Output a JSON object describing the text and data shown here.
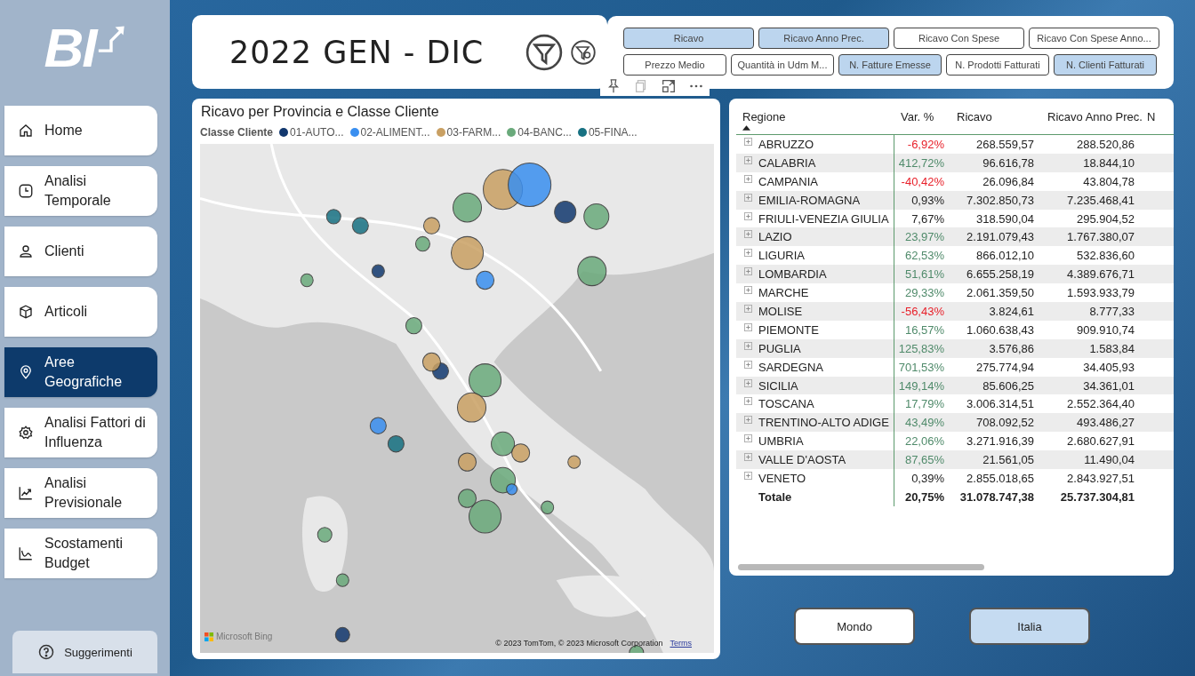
{
  "logo": "BI",
  "nav": [
    {
      "label": "Home",
      "kind": "home",
      "selected": false
    },
    {
      "label": "Analisi Temporale",
      "kind": "clock",
      "selected": false
    },
    {
      "label": "Clienti",
      "kind": "person",
      "selected": false
    },
    {
      "label": "Articoli",
      "kind": "box",
      "selected": false
    },
    {
      "label": "Aree Geografiche",
      "kind": "pin",
      "selected": true
    },
    {
      "label": "Analisi Fattori di Influenza",
      "kind": "gear",
      "selected": false
    },
    {
      "label": "Analisi Previsionale",
      "kind": "trend",
      "selected": false
    },
    {
      "label": "Scostamenti Budget",
      "kind": "curve",
      "selected": false
    }
  ],
  "help_button": "Suggerimenti",
  "title": "2022 GEN - DIC",
  "measures": [
    [
      {
        "label": "Ricavo",
        "selected": true
      },
      {
        "label": "Ricavo Anno Prec.",
        "selected": true
      },
      {
        "label": "Ricavo Con Spese",
        "selected": false
      },
      {
        "label": "Ricavo Con Spese Anno...",
        "selected": false
      }
    ],
    [
      {
        "label": "Prezzo Medio",
        "selected": false
      },
      {
        "label": "Quantità in Udm M...",
        "selected": false
      },
      {
        "label": "N. Fatture Emesse",
        "selected": true
      },
      {
        "label": "N. Prodotti Fatturati",
        "selected": false
      },
      {
        "label": "N. Clienti Fatturati",
        "selected": true
      }
    ]
  ],
  "map": {
    "title": "Ricavo per Provincia e Classe Cliente",
    "legend_title": "Classe Cliente",
    "legend": [
      {
        "label": "01-AUTO...",
        "color": "#12386e"
      },
      {
        "label": "02-ALIMENT...",
        "color": "#3a8ff0"
      },
      {
        "label": "03-FARM...",
        "color": "#c9a063"
      },
      {
        "label": "04-BANC...",
        "color": "#6aaa7b"
      },
      {
        "label": "05-FINA...",
        "color": "#177182"
      }
    ],
    "provider": "Microsoft Bing",
    "attribution": "© 2023 TomTom, © 2023 Microsoft Corporation",
    "terms": "Terms"
  },
  "table": {
    "columns": [
      "Regione",
      "Var. %",
      "Ricavo",
      "Ricavo Anno Prec.",
      "N"
    ],
    "rows": [
      {
        "region": "ABRUZZO",
        "var": "-6,92%",
        "color": "#e8202a",
        "ricavo": "268.559,57",
        "prec": "288.520,86"
      },
      {
        "region": "CALABRIA",
        "var": "412,72%",
        "color": "#4f8a6a",
        "ricavo": "96.616,78",
        "prec": "18.844,10"
      },
      {
        "region": "CAMPANIA",
        "var": "-40,42%",
        "color": "#e8202a",
        "ricavo": "26.096,84",
        "prec": "43.804,78"
      },
      {
        "region": "EMILIA-ROMAGNA",
        "var": "0,93%",
        "color": "#222222",
        "ricavo": "7.302.850,73",
        "prec": "7.235.468,41"
      },
      {
        "region": "FRIULI-VENEZIA GIULIA",
        "var": "7,67%",
        "color": "#222222",
        "ricavo": "318.590,04",
        "prec": "295.904,52"
      },
      {
        "region": "LAZIO",
        "var": "23,97%",
        "color": "#4f8a6a",
        "ricavo": "2.191.079,43",
        "prec": "1.767.380,07"
      },
      {
        "region": "LIGURIA",
        "var": "62,53%",
        "color": "#4f8a6a",
        "ricavo": "866.012,10",
        "prec": "532.836,60"
      },
      {
        "region": "LOMBARDIA",
        "var": "51,61%",
        "color": "#4f8a6a",
        "ricavo": "6.655.258,19",
        "prec": "4.389.676,71"
      },
      {
        "region": "MARCHE",
        "var": "29,33%",
        "color": "#4f8a6a",
        "ricavo": "2.061.359,50",
        "prec": "1.593.933,79"
      },
      {
        "region": "MOLISE",
        "var": "-56,43%",
        "color": "#e8202a",
        "ricavo": "3.824,61",
        "prec": "8.777,33"
      },
      {
        "region": "PIEMONTE",
        "var": "16,57%",
        "color": "#4f8a6a",
        "ricavo": "1.060.638,43",
        "prec": "909.910,74"
      },
      {
        "region": "PUGLIA",
        "var": "125,83%",
        "color": "#4f8a6a",
        "ricavo": "3.576,86",
        "prec": "1.583,84"
      },
      {
        "region": "SARDEGNA",
        "var": "701,53%",
        "color": "#4f8a6a",
        "ricavo": "275.774,94",
        "prec": "34.405,93"
      },
      {
        "region": "SICILIA",
        "var": "149,14%",
        "color": "#4f8a6a",
        "ricavo": "85.606,25",
        "prec": "34.361,01"
      },
      {
        "region": "TOSCANA",
        "var": "17,79%",
        "color": "#4f8a6a",
        "ricavo": "3.006.314,51",
        "prec": "2.552.364,40"
      },
      {
        "region": "TRENTINO-ALTO ADIGE",
        "var": "43,49%",
        "color": "#4f8a6a",
        "ricavo": "708.092,52",
        "prec": "493.486,27"
      },
      {
        "region": "UMBRIA",
        "var": "22,06%",
        "color": "#4f8a6a",
        "ricavo": "3.271.916,39",
        "prec": "2.680.627,91"
      },
      {
        "region": "VALLE D'AOSTA",
        "var": "87,65%",
        "color": "#4f8a6a",
        "ricavo": "21.561,05",
        "prec": "11.490,04"
      },
      {
        "region": "VENETO",
        "var": "0,39%",
        "color": "#222222",
        "ricavo": "2.855.018,65",
        "prec": "2.843.927,51"
      }
    ],
    "total": {
      "label": "Totale",
      "var": "20,75%",
      "ricavo": "31.078.747,38",
      "prec": "25.737.304,81"
    }
  },
  "scope": [
    {
      "label": "Mondo",
      "selected": false
    },
    {
      "label": "Italia",
      "selected": true
    }
  ]
}
